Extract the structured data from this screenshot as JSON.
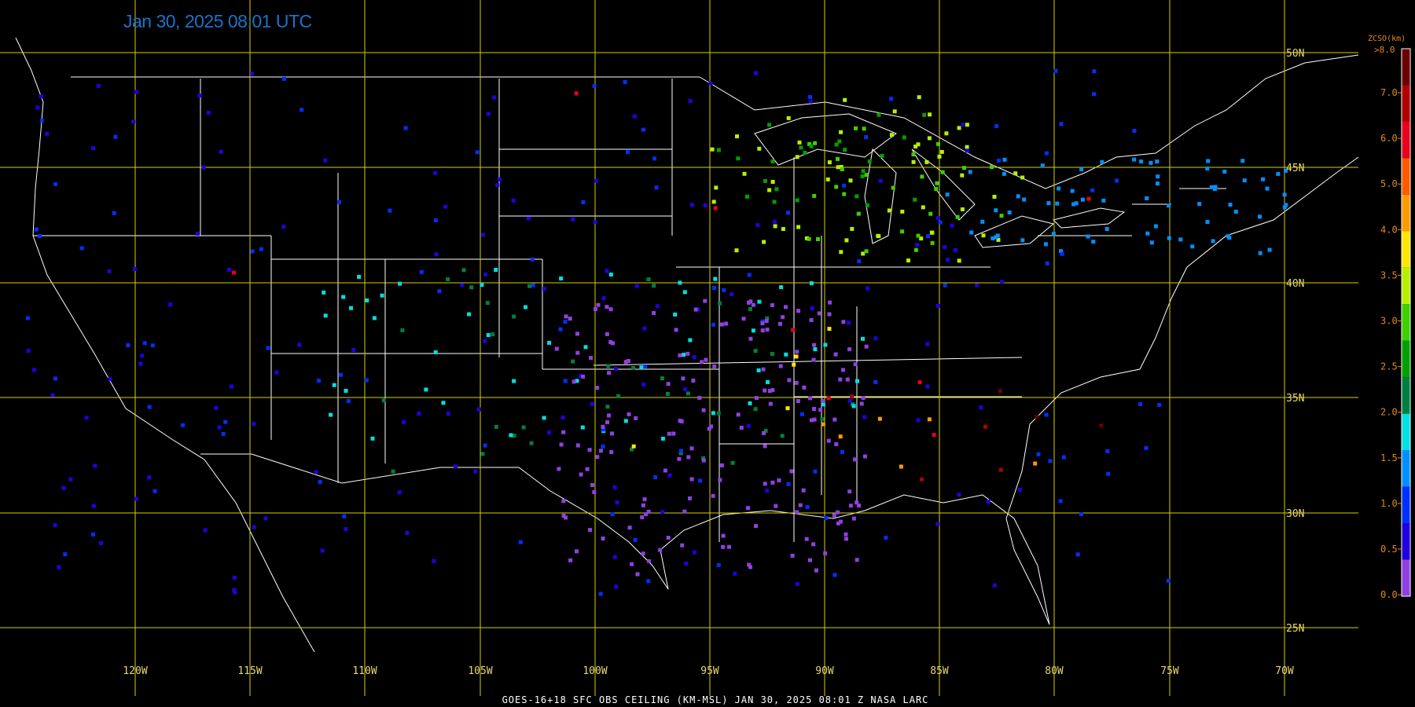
{
  "header": {
    "timestamp": "Jan 30, 2025 08:01 UTC"
  },
  "footer": {
    "caption": "GOES-16+18  SFC OBS CEILING (KM-MSL)   JAN 30, 2025 08:01 Z   NASA LARC"
  },
  "grid": {
    "longitude_labels": [
      "120W",
      "115W",
      "110W",
      "105W",
      "100W",
      "95W",
      "90W",
      "85W",
      "80W",
      "75W",
      "70W"
    ],
    "latitude_labels": [
      "50N",
      "45N",
      "40N",
      "35N",
      "30N",
      "25N"
    ]
  },
  "legend": {
    "title": "ZCSO(km)",
    "max_label": ">8.0",
    "tick_labels": [
      "7.0",
      "6.0",
      "5.0",
      "4.0",
      "3.5",
      "3.0",
      "2.5",
      "2.0",
      "1.5",
      "1.0",
      "0.5",
      "0.0"
    ],
    "colors_top_to_bottom": [
      "#6b0000",
      "#b00000",
      "#e8001c",
      "#ff5a00",
      "#ff9a00",
      "#ffe600",
      "#b6f000",
      "#3fd000",
      "#00a000",
      "#008040",
      "#00e0e0",
      "#0090ff",
      "#0030ff",
      "#2000e0",
      "#9040e0"
    ]
  },
  "colors": {
    "grid_line": "#d8d000",
    "grid_label": "#e8d870",
    "borders": "#ffffff",
    "timestamp": "#1a73c9",
    "legend_text": "#e08a1a"
  },
  "observations": [
    {
      "c": 6,
      "n": 60
    },
    {
      "c": 7,
      "n": 30
    },
    {
      "c": 8,
      "n": 25
    },
    {
      "c": 9,
      "n": 40
    },
    {
      "c": 10,
      "n": 55
    },
    {
      "c": 11,
      "n": 70
    },
    {
      "c": 12,
      "n": 110
    },
    {
      "c": 13,
      "n": 140
    },
    {
      "c": 14,
      "n": 180
    },
    {
      "c": 4,
      "n": 6
    },
    {
      "c": 2,
      "n": 8
    },
    {
      "c": 0,
      "n": 3
    },
    {
      "c": 5,
      "n": 5
    },
    {
      "c": 1,
      "n": 4
    }
  ]
}
